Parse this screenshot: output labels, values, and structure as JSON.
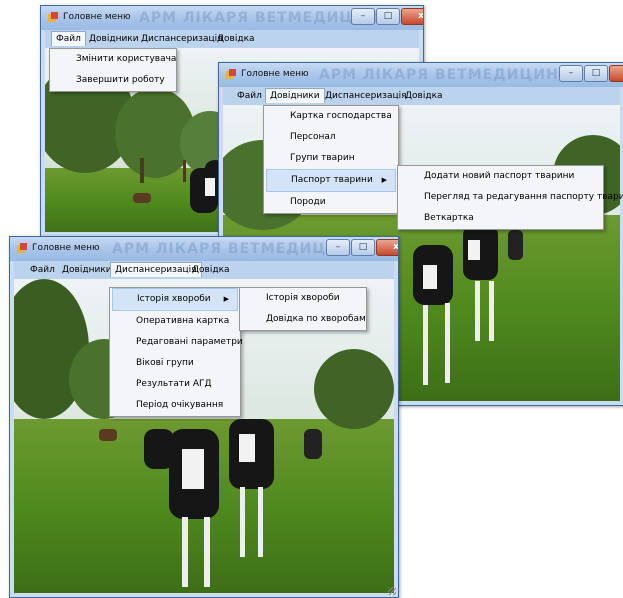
{
  "window_title": "Головне меню",
  "watermark": "АРМ ЛІКАРЯ ВЕТМЕДИЦИНИ",
  "controls": {
    "minimize": "–",
    "maximize": "□",
    "close": "x"
  },
  "menu": {
    "file": "Файл",
    "directories": "Довідники",
    "dispensary": "Диспансеризація",
    "help": "Довідка"
  },
  "file_menu": [
    "Змінити користувача",
    "Завершити роботу"
  ],
  "directories_menu": [
    "Картка господарства",
    "Персонал",
    "Групи тварин",
    "Паспорт тварини",
    "Породи"
  ],
  "passport_submenu": [
    "Додати новий паспорт тварини",
    "Перегляд та редагування паспорту тварини",
    "Веткартка"
  ],
  "dispensary_menu": [
    "Історія хвороби",
    "Оперативна картка",
    "Редаговані параметри",
    "Вікові групи",
    "Результати АГД",
    "Період очікування"
  ],
  "history_submenu": [
    "Історія хвороби",
    "Довідка по хворобам"
  ],
  "colors": {
    "titlebar": "#a6c3e8",
    "menubar": "#bcd3ee",
    "highlight": "#d4e4f7",
    "grass": "#4f8a1e",
    "sky": "#cfe0ee"
  }
}
